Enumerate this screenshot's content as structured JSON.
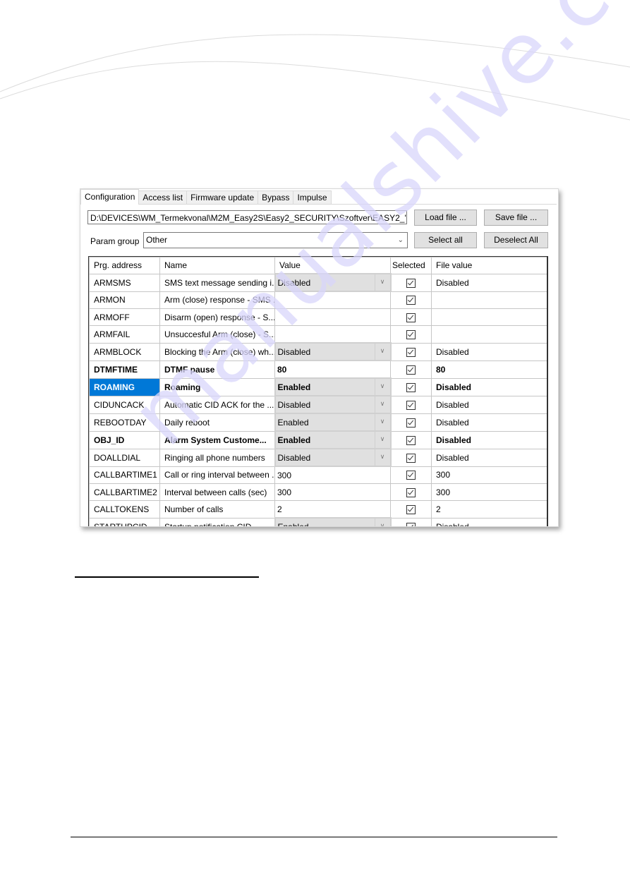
{
  "watermark": "manualshive.com",
  "window": {
    "tabs": [
      {
        "label": "Configuration",
        "active": true
      },
      {
        "label": "Access list",
        "active": false
      },
      {
        "label": "Firmware update",
        "active": false
      },
      {
        "label": "Bypass",
        "active": false
      },
      {
        "label": "Impulse",
        "active": false
      }
    ],
    "file_path": "D:\\DEVICES\\WM_Termekvonal\\M2M_Easy2S\\Easy2_SECURITY\\Szoftver\\EASY2_'",
    "load_file_label": "Load file ...",
    "save_file_label": "Save file ...",
    "param_group_label": "Param group",
    "param_group_value": "Other",
    "select_all_label": "Select all",
    "deselect_all_label": "Deselect All"
  },
  "grid": {
    "columns": [
      "Prg. address",
      "Name",
      "Value",
      "Selected",
      "File value"
    ],
    "rows": [
      {
        "address": "ARMSMS",
        "name": "SMS text message sending i...",
        "value": "Disabled",
        "dropdown": true,
        "selected": true,
        "file_value": "Disabled",
        "bold": false,
        "highlighted": false
      },
      {
        "address": "ARMON",
        "name": "Arm (close) response - SMS ...",
        "value": "",
        "dropdown": false,
        "selected": true,
        "file_value": "",
        "bold": false,
        "highlighted": false
      },
      {
        "address": "ARMOFF",
        "name": "Disarm (open) response - S...",
        "value": "",
        "dropdown": false,
        "selected": true,
        "file_value": "",
        "bold": false,
        "highlighted": false
      },
      {
        "address": "ARMFAIL",
        "name": "Unsuccesful Arm (close) - S...",
        "value": "",
        "dropdown": false,
        "selected": true,
        "file_value": "",
        "bold": false,
        "highlighted": false
      },
      {
        "address": "ARMBLOCK",
        "name": "Blocking the Arm (close) wh...",
        "value": "Disabled",
        "dropdown": true,
        "selected": true,
        "file_value": "Disabled",
        "bold": false,
        "highlighted": false
      },
      {
        "address": "DTMFTIME",
        "name": "DTMF pause",
        "value": "80",
        "dropdown": false,
        "selected": true,
        "file_value": "80",
        "bold": true,
        "highlighted": false
      },
      {
        "address": "ROAMING",
        "name": "Roaming",
        "value": "Enabled",
        "dropdown": true,
        "selected": true,
        "file_value": "Disabled",
        "bold": true,
        "highlighted": true
      },
      {
        "address": "CIDUNCACK",
        "name": "Automatic CID ACK for the ...",
        "value": "Disabled",
        "dropdown": true,
        "selected": true,
        "file_value": "Disabled",
        "bold": false,
        "highlighted": false
      },
      {
        "address": "REBOOTDAY",
        "name": "Daily reboot",
        "value": "Enabled",
        "dropdown": true,
        "selected": true,
        "file_value": "Disabled",
        "bold": false,
        "highlighted": false
      },
      {
        "address": "OBJ_ID",
        "name": "Alarm System Custome...",
        "value": "Enabled",
        "dropdown": true,
        "selected": true,
        "file_value": "Disabled",
        "bold": true,
        "highlighted": false
      },
      {
        "address": "DOALLDIAL",
        "name": "Ringing all phone numbers",
        "value": "Disabled",
        "dropdown": true,
        "selected": true,
        "file_value": "Disabled",
        "bold": false,
        "highlighted": false
      },
      {
        "address": "CALLBARTIME1",
        "name": "Call or ring interval between ...",
        "value": "300",
        "dropdown": false,
        "selected": true,
        "file_value": "300",
        "bold": false,
        "highlighted": false
      },
      {
        "address": "CALLBARTIME2",
        "name": "Interval between calls (sec)",
        "value": "300",
        "dropdown": false,
        "selected": true,
        "file_value": "300",
        "bold": false,
        "highlighted": false
      },
      {
        "address": "CALLTOKENS",
        "name": "Number of calls",
        "value": "2",
        "dropdown": false,
        "selected": true,
        "file_value": "2",
        "bold": false,
        "highlighted": false
      },
      {
        "address": "STARTUPCID",
        "name": "Startup notification CID",
        "value": "Enabled",
        "dropdown": true,
        "selected": true,
        "file_value": "Disabled",
        "bold": false,
        "highlighted": false
      }
    ]
  },
  "colors": {
    "selection_blue": "#0078d7",
    "dropdown_bg": "#e0e0e0",
    "watermark": "#d9d6fb"
  }
}
